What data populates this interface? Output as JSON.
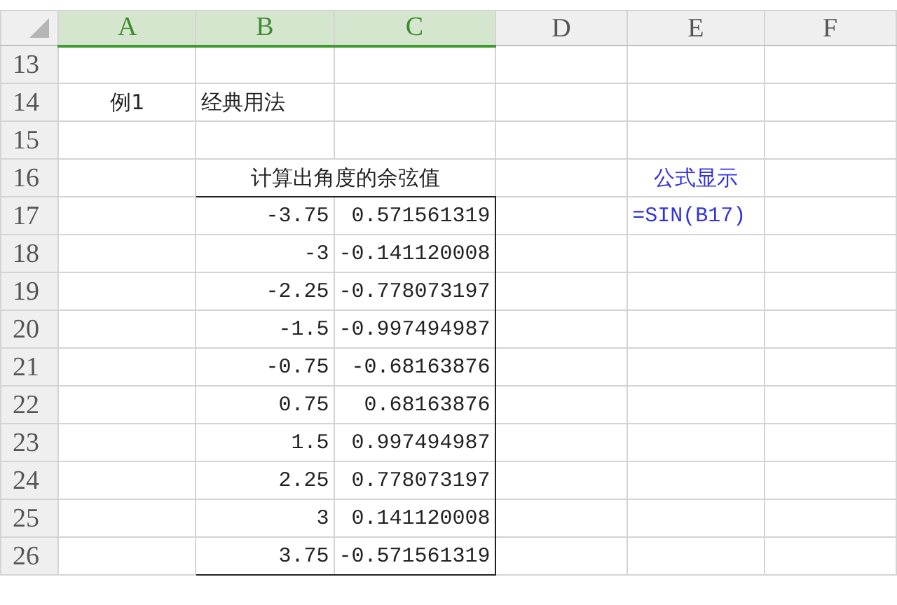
{
  "columns": [
    {
      "label": "A",
      "selected": true
    },
    {
      "label": "B",
      "selected": true
    },
    {
      "label": "C",
      "selected": true
    },
    {
      "label": "D",
      "selected": false
    },
    {
      "label": "E",
      "selected": false
    },
    {
      "label": "F",
      "selected": false
    }
  ],
  "rows": [
    {
      "number": "13",
      "kind": "blank"
    },
    {
      "number": "14",
      "kind": "label",
      "a": "例1",
      "b": "经典用法"
    },
    {
      "number": "15",
      "kind": "blank"
    },
    {
      "number": "16",
      "kind": "title",
      "title": "计算出角度的余弦值",
      "e": "公式显示"
    },
    {
      "number": "17",
      "kind": "value",
      "b": "-3.75",
      "c": "0.571561319",
      "e": "=SIN(B17)"
    },
    {
      "number": "18",
      "kind": "value",
      "b": "-3",
      "c": "-0.141120008"
    },
    {
      "number": "19",
      "kind": "value",
      "b": "-2.25",
      "c": "-0.778073197"
    },
    {
      "number": "20",
      "kind": "value",
      "b": "-1.5",
      "c": "-0.997494987"
    },
    {
      "number": "21",
      "kind": "value",
      "b": "-0.75",
      "c": "-0.68163876"
    },
    {
      "number": "22",
      "kind": "value",
      "b": "0.75",
      "c": "0.68163876"
    },
    {
      "number": "23",
      "kind": "value",
      "b": "1.5",
      "c": "0.997494987"
    },
    {
      "number": "24",
      "kind": "value",
      "b": "2.25",
      "c": "0.778073197"
    },
    {
      "number": "25",
      "kind": "value",
      "b": "3",
      "c": "0.141120008"
    },
    {
      "number": "26",
      "kind": "value",
      "b": "3.75",
      "c": "-0.571561319"
    }
  ]
}
